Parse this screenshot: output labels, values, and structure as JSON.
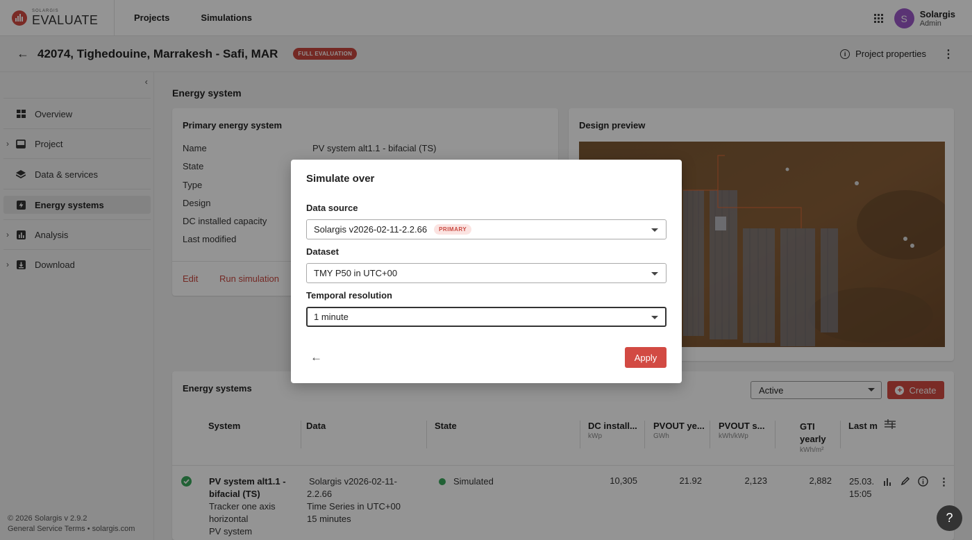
{
  "app": {
    "logo_small": "SOLARGIS",
    "logo_big": "EVALUATE",
    "nav": [
      "Projects",
      "Simulations"
    ],
    "user_name": "Solargis",
    "user_role": "Admin",
    "user_initial": "S"
  },
  "project": {
    "title": "42074, Tighedouine, Marrakesh - Safi, MAR",
    "badge": "FULL EVALUATION",
    "properties_label": "Project properties"
  },
  "sidebar": {
    "items": [
      {
        "label": "Overview",
        "icon": "grid-icon"
      },
      {
        "label": "Project",
        "icon": "inbox-icon"
      },
      {
        "label": "Data & services",
        "icon": "layers-icon"
      },
      {
        "label": "Energy systems",
        "icon": "bolt-icon"
      },
      {
        "label": "Analysis",
        "icon": "bar-chart-icon"
      },
      {
        "label": "Download",
        "icon": "download-icon"
      }
    ],
    "footer_line1": "© 2026 Solargis v 2.9.2",
    "footer_line2": "General Service Terms • solargis.com"
  },
  "main": {
    "section_title": "Energy system",
    "primary": {
      "title": "Primary energy system",
      "labels": [
        "Name",
        "State",
        "Type",
        "Design",
        "DC installed capacity",
        "Last modified"
      ],
      "name_value": "PV system alt1.1 - bifacial (TS)",
      "edit_label": "Edit",
      "run_label": "Run simulation"
    },
    "design_preview_title": "Design preview",
    "systems": {
      "title": "Energy systems",
      "filter_value": "Active",
      "create_label": "Create",
      "columns": [
        {
          "label": "System",
          "unit": ""
        },
        {
          "label": "Data",
          "unit": ""
        },
        {
          "label": "State",
          "unit": ""
        },
        {
          "label": "DC install...",
          "unit": "kWp"
        },
        {
          "label": "PVOUT ye...",
          "unit": "GWh"
        },
        {
          "label": "PVOUT s...",
          "unit": "kWh/kWp"
        },
        {
          "label": "GTI yearly",
          "unit": "kWh/m²"
        },
        {
          "label": "Last m",
          "unit": ""
        }
      ],
      "row": {
        "system_name": "PV system alt1.1 - bifacial (TS)",
        "system_name_l1": "PV system alt1.1 -",
        "system_name_l2": "bifacial (TS)",
        "system_desc1": "Tracker one axis",
        "system_desc2": "horizontal",
        "system_desc3": "PV system",
        "data1": "Solargis v2026-02-11-",
        "data2": "2.2.66",
        "data3": "Time Series in UTC+00",
        "data4": "15 minutes",
        "state": "Simulated",
        "dc": "10,305",
        "pvout_yearly": "21.92",
        "pvout_specific": "2,123",
        "gti": "2,882",
        "last_modified1": "25.03.",
        "last_modified2": "15:05"
      }
    }
  },
  "dialog": {
    "title": "Simulate over",
    "data_source_label": "Data source",
    "data_source_value": "Solargis v2026-02-11-2.2.66",
    "data_source_badge": "PRIMARY",
    "dataset_label": "Dataset",
    "dataset_value": "TMY P50 in UTC+00",
    "resolution_label": "Temporal resolution",
    "resolution_value": "1 minute",
    "apply_label": "Apply"
  },
  "help_label": "?",
  "colors": {
    "accent": "#d24a43",
    "success": "#3aa85c",
    "avatar": "#9b59c9"
  }
}
